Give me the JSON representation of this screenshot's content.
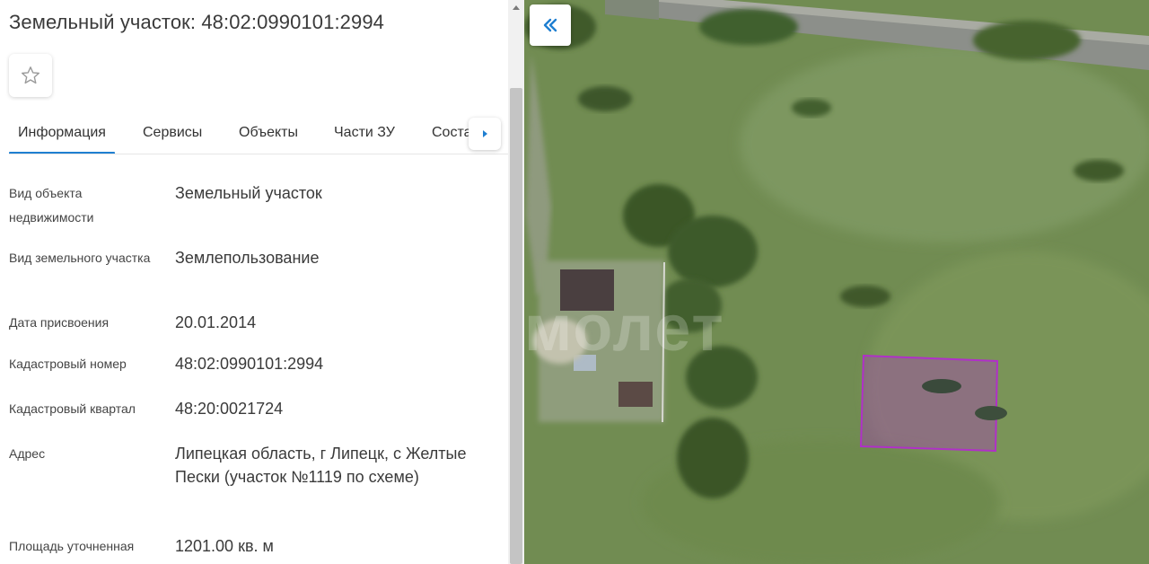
{
  "panel": {
    "title": "Земельный участок: 48:02:0990101:2994",
    "tabs": [
      {
        "label": "Информация",
        "active": true
      },
      {
        "label": "Сервисы"
      },
      {
        "label": "Объекты"
      },
      {
        "label": "Части ЗУ"
      },
      {
        "label": "Состав"
      }
    ],
    "rows": [
      {
        "label": "Вид объекта недвижимости",
        "value": "Земельный участок"
      },
      {
        "label": "Вид земельного участка",
        "value": "Землепользование"
      },
      {
        "label": "Дата присвоения",
        "value": "20.01.2014"
      },
      {
        "label": "Кадастровый номер",
        "value": "48:02:0990101:2994"
      },
      {
        "label": "Кадастровый квартал",
        "value": "48:20:0021724"
      },
      {
        "label": "Адрес",
        "value": "Липецкая область, г Липецк, с Желтые Пески (участок №1119 по схеме)"
      },
      {
        "label": "Площадь уточненная",
        "value": "1201.00 кв. м"
      }
    ]
  },
  "map": {
    "watermark": "молет",
    "parcel_color": "#b030c8",
    "accent": "#1f7fd1"
  }
}
